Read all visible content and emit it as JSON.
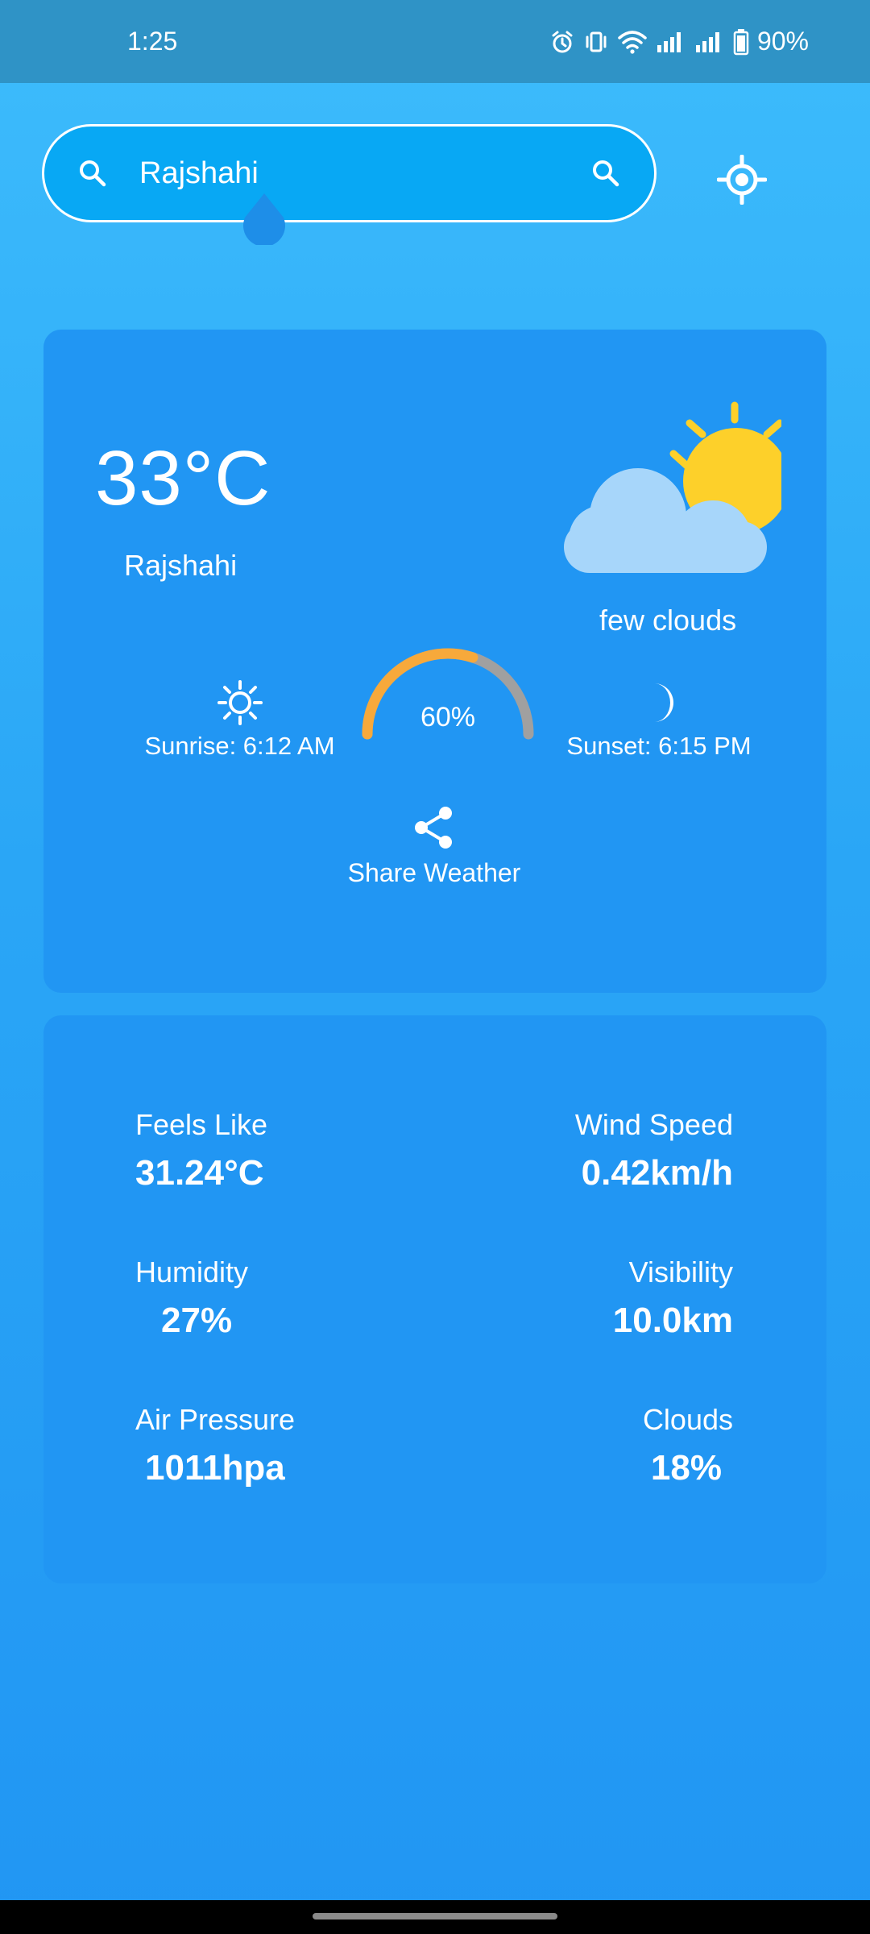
{
  "status_bar": {
    "time": "1:25",
    "battery": "90%",
    "icons": [
      "alarm-icon",
      "vibrate-icon",
      "wifi-icon",
      "signal-icon",
      "signal-icon",
      "battery-icon"
    ]
  },
  "search": {
    "value": "Rajshahi",
    "lead_icon": "search-icon",
    "trail_icon": "search-icon",
    "location_icon": "gps-target-icon"
  },
  "current": {
    "temperature": "33°C",
    "city": "Rajshahi",
    "condition": "few clouds",
    "condition_icon": "sun-behind-cloud-icon"
  },
  "sun": {
    "sunrise": "Sunrise: 6:12 AM",
    "sunset": "Sunset: 6:15 PM",
    "sunrise_icon": "sun-icon",
    "sunset_icon": "moon-icon"
  },
  "day_progress": {
    "label": "60%",
    "fraction": 0.6
  },
  "share": {
    "label": "Share Weather",
    "icon": "share-icon"
  },
  "details": {
    "feels_like": {
      "label": "Feels Like",
      "value": "31.24°C"
    },
    "wind_speed": {
      "label": "Wind Speed",
      "value": "0.42km/h"
    },
    "humidity": {
      "label": "Humidity",
      "value": "27%"
    },
    "visibility": {
      "label": "Visibility",
      "value": "10.0km"
    },
    "air_pressure": {
      "label": "Air Pressure",
      "value": "1011hpa"
    },
    "clouds": {
      "label": "Clouds",
      "value": "18%"
    }
  },
  "colors": {
    "card": "#2196f3",
    "search_field": "#08a8f4",
    "status_bar": "#2f93c6",
    "gauge_filled": "#f7a93b",
    "gauge_track": "#a0a0a0",
    "sun_yellow": "#fdd02a",
    "cloud": "#a7d6fa"
  }
}
